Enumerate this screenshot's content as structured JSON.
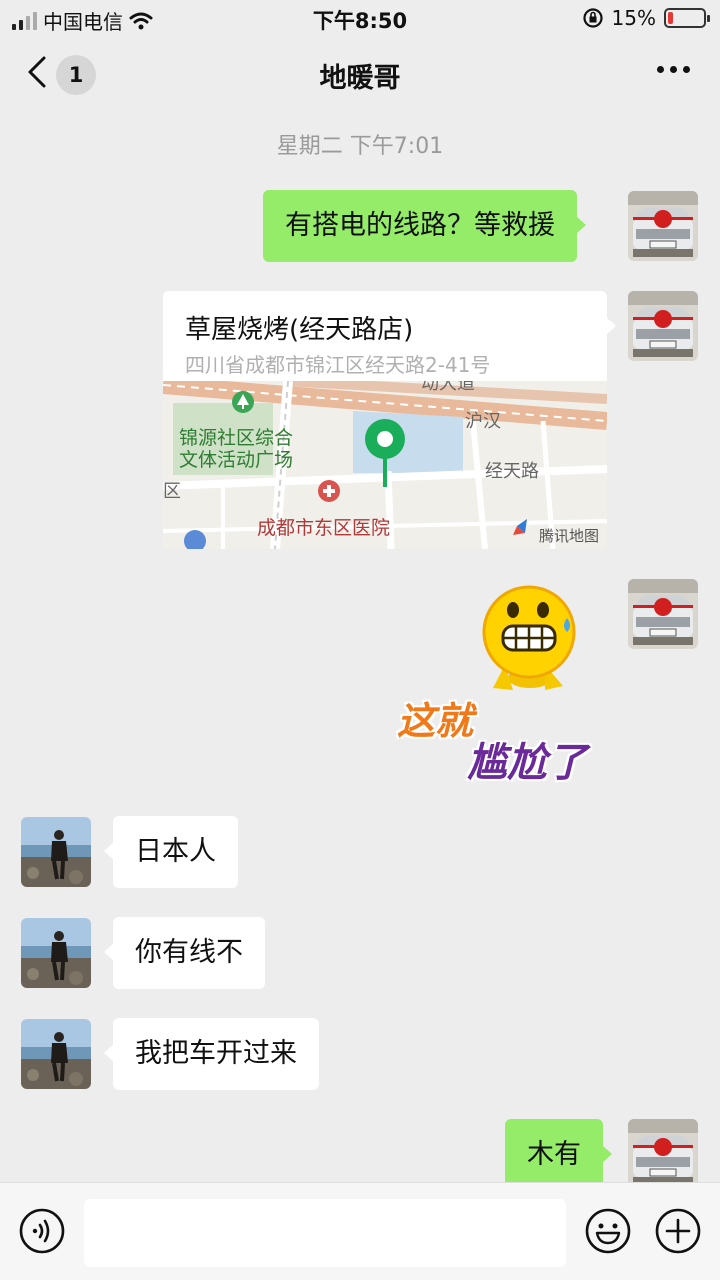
{
  "status_bar": {
    "carrier": "中国电信",
    "time": "下午8:50",
    "battery": "15%",
    "battery_level": 0.15
  },
  "nav": {
    "back_badge": "1",
    "title": "地暖哥"
  },
  "timestamp": "星期二 下午7:01",
  "messages": [
    {
      "from": "me",
      "text": "有搭电的线路？等救援"
    },
    {
      "from": "me",
      "type": "location",
      "name": "草屋烧烤(经天路店)",
      "address": "四川省成都市锦江区经天路2-41号",
      "map_labels": {
        "park": "锦源社区综合",
        "park2": "文体活动广场",
        "hospital": "成都市东区医院",
        "road1": "沪汉",
        "road2": "经天路",
        "road3": "动大道",
        "edge": "区",
        "provider": "腾讯地图"
      }
    },
    {
      "from": "me",
      "type": "sticker",
      "line1": "这就",
      "line2": "尴尬了"
    },
    {
      "from": "them",
      "text": "日本人"
    },
    {
      "from": "them",
      "text": "你有线不"
    },
    {
      "from": "them",
      "text": "我把车开过来"
    },
    {
      "from": "me",
      "text": "木有"
    }
  ],
  "colors": {
    "my_bubble": "#95ec69",
    "their_bubble": "#ffffff",
    "background": "#ededed"
  }
}
